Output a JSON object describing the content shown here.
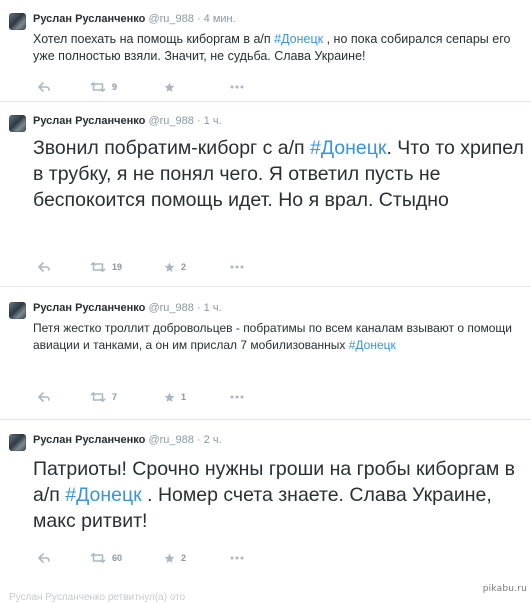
{
  "tweets": [
    {
      "name": "Руслан Русланченко",
      "handle": "@ru_988",
      "separator": "·",
      "time": "4 мин.",
      "text_before": "Хотел поехать на помощь киборгам в а/п ",
      "hashtag": "#Донецк",
      "text_after": " , но пока собирался сепары его уже полностью взяли. Значит, не судьба. Слава Украине!",
      "retweets": "9",
      "favorites": ""
    },
    {
      "name": "Руслан Русланченко",
      "handle": "@ru_988",
      "separator": "·",
      "time": "1 ч.",
      "text_before": "Звонил побратим-киборг с а/п ",
      "hashtag": "#Донецк",
      "text_after": ". Что то хрипел в трубку, я не понял чего. Я ответил пусть не беспокоится помощь идет. Но я врал. Стыдно",
      "retweets": "19",
      "favorites": "2"
    },
    {
      "name": "Руслан Русланченко",
      "handle": "@ru_988",
      "separator": "·",
      "time": "1 ч.",
      "text_before": "Петя жестко троллит добровольцев - побратимы по  всем каналам взывают о помощи авиации и танками, а он им прислал 7 мобилизованных ",
      "hashtag": "#Донецк",
      "text_after": "",
      "retweets": "7",
      "favorites": "1"
    },
    {
      "name": "Руслан Русланченко",
      "handle": "@ru_988",
      "separator": "·",
      "time": "2 ч.",
      "text_before": "Патриоты! Срочно нужны гроши на гробы киборгам в а/п ",
      "hashtag": "#Донецк",
      "text_after": " . Номер счета знаете. Слава Украине, макс ритвит!",
      "retweets": "60",
      "favorites": "2"
    }
  ],
  "partial_line": "Руслан Русланченко ретвитнул(а) ото",
  "watermark": "pikabu.ru",
  "icons": {
    "reply": "reply-icon",
    "retweet": "retweet-icon",
    "favorite": "favorite-star-icon",
    "more": "more-dots-icon"
  },
  "colors": {
    "text": "#292f33",
    "meta": "#8899a6",
    "hashtag": "#3b94d9",
    "action_icon": "#aab8c2",
    "divider": "#e1e8ed"
  }
}
